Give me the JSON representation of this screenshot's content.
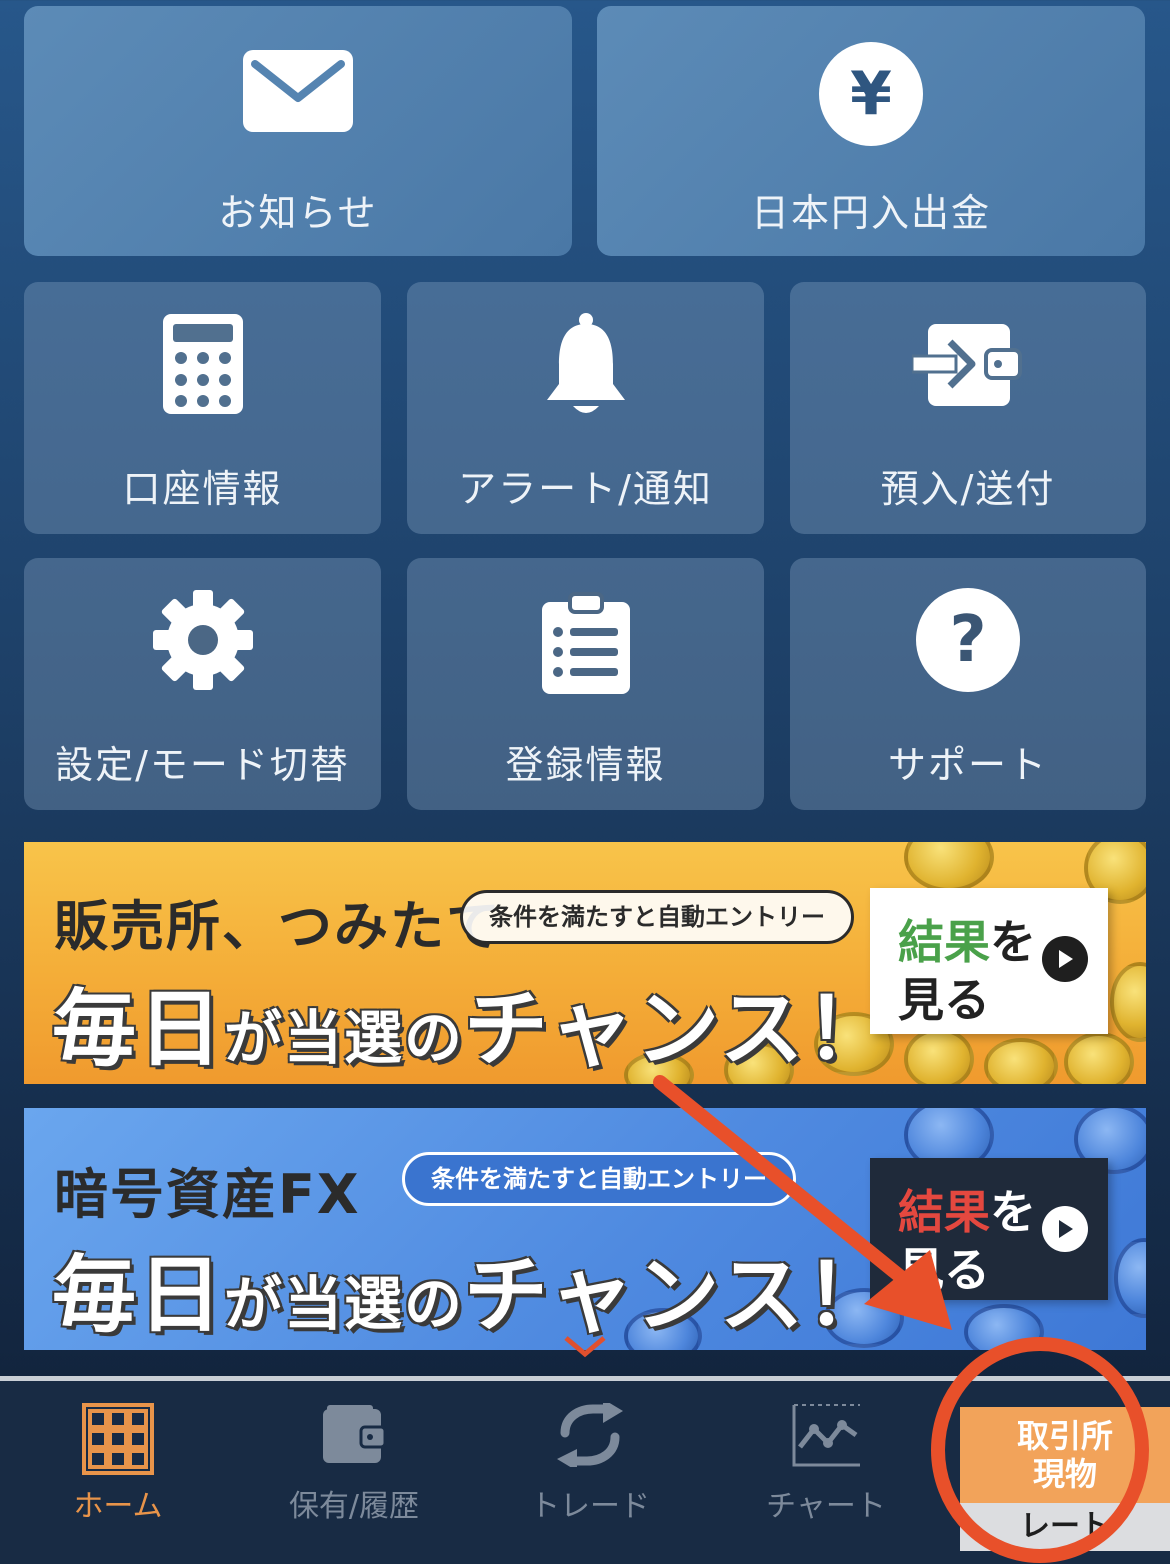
{
  "tiles": {
    "notice": {
      "label": "お知らせ"
    },
    "jpy": {
      "label": "日本円入出金",
      "symbol": "¥"
    },
    "account": {
      "label": "口座情報"
    },
    "alert": {
      "label": "アラート/通知"
    },
    "deposit": {
      "label": "預入/送付"
    },
    "settings": {
      "label": "設定/モード切替"
    },
    "registration": {
      "label": "登録情報"
    },
    "support": {
      "label": "サポート",
      "symbol": "?"
    }
  },
  "banners": {
    "orange": {
      "headline": "販売所、つみたて",
      "pill": "条件を満たすと自動エントリー",
      "big_a": "毎日",
      "big_b": "が当選の",
      "big_c": "チャンス！",
      "result_hl": "結果",
      "result_rest": "を",
      "result_line2": "見る"
    },
    "blue": {
      "headline": "暗号資産FX",
      "pill": "条件を満たすと自動エントリー",
      "big_a": "毎日",
      "big_b": "が当選の",
      "big_c": "チャンス！",
      "result_hl": "結果",
      "result_rest": "を",
      "result_line2": "見る"
    }
  },
  "nav": {
    "home": "ホーム",
    "holdings": "保有/履歴",
    "trade": "トレード",
    "chart": "チャート",
    "rate_line1": "取引所",
    "rate_line2": "現物",
    "rate_line3": "レート"
  },
  "colors": {
    "accent": "#e8944a",
    "annotation": "#e8502a"
  }
}
